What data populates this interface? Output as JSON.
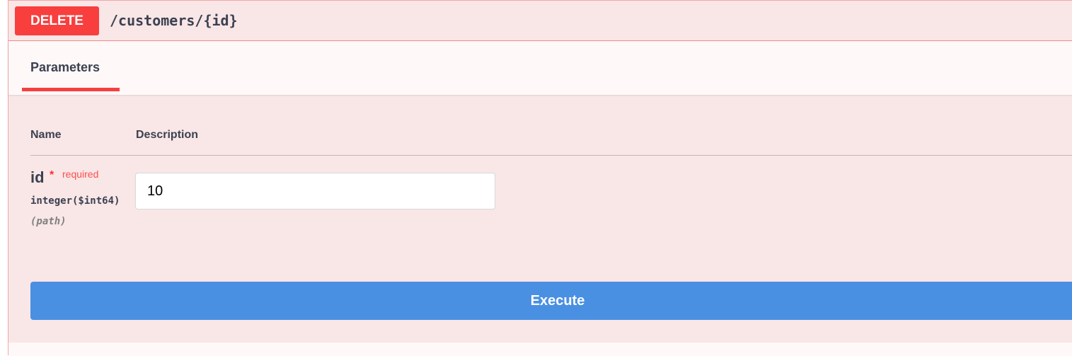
{
  "operation": {
    "method": "DELETE",
    "path": "/customers/{id}",
    "color": "#f93e3e"
  },
  "tabs": [
    {
      "label": "Parameters",
      "active": true
    }
  ],
  "params_table": {
    "headers": {
      "name": "Name",
      "description": "Description"
    },
    "rows": [
      {
        "name": "id",
        "required_star": "*",
        "required_label": "required",
        "type": "integer($int64)",
        "in": "(path)",
        "value": "10"
      }
    ]
  },
  "actions": {
    "execute_label": "Execute",
    "execute_color": "#4990e2"
  }
}
